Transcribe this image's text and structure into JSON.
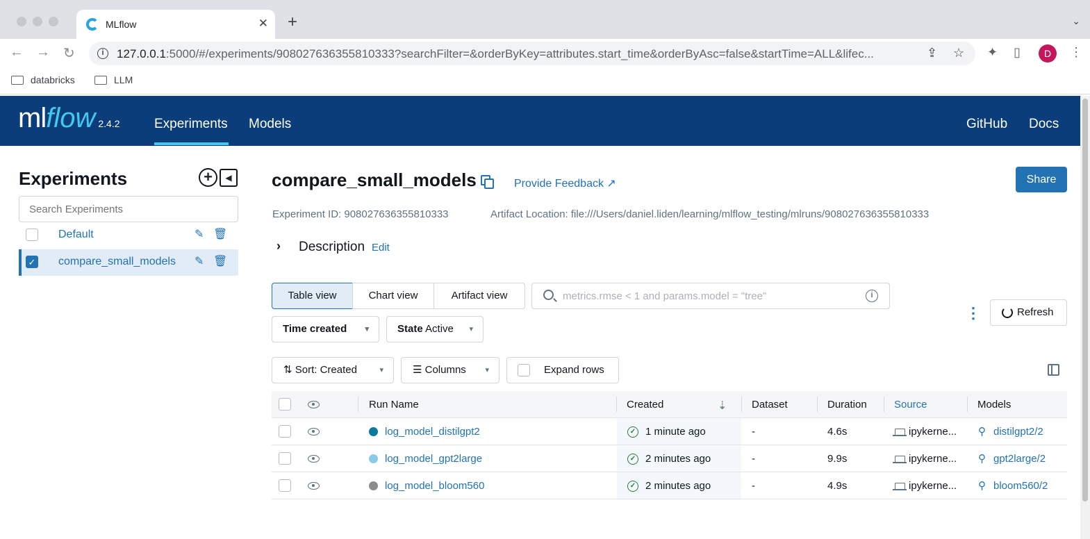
{
  "browser": {
    "tab_title": "MLflow",
    "url_host": "127.0.0.1",
    "url_rest": ":5000/#/experiments/908027636355810333?searchFilter=&orderByKey=attributes.start_time&orderByAsc=false&startTime=ALL&lifec...",
    "profile_initial": "D",
    "bookmarks": [
      "databricks",
      "LLM"
    ]
  },
  "header": {
    "logo_ml": "ml",
    "logo_flow": "flow",
    "version": "2.4.2",
    "nav": [
      "Experiments",
      "Models"
    ],
    "right_links": [
      "GitHub",
      "Docs"
    ]
  },
  "sidebar": {
    "title": "Experiments",
    "search_placeholder": "Search Experiments",
    "experiments": [
      {
        "name": "Default",
        "selected": false
      },
      {
        "name": "compare_small_models",
        "selected": true
      }
    ]
  },
  "experiment": {
    "name": "compare_small_models",
    "feedback_label": "Provide Feedback",
    "share_label": "Share",
    "id_text": "Experiment ID: 908027636355810333",
    "artifact_text": "Artifact Location: file:///Users/daniel.liden/learning/mlflow_testing/mlruns/908027636355810333",
    "description_label": "Description",
    "description_edit": "Edit"
  },
  "controls": {
    "views": [
      "Table view",
      "Chart view",
      "Artifact view"
    ],
    "search_placeholder": "metrics.rmse < 1 and params.model = \"tree\"",
    "refresh_label": "Refresh",
    "time_filter": "Time created",
    "state_label": "State",
    "state_value": "Active",
    "sort_label": "Sort: Created",
    "columns_label": "Columns",
    "expand_label": "Expand rows"
  },
  "table": {
    "headers": [
      "Run Name",
      "Created",
      "Dataset",
      "Duration",
      "Source",
      "Models"
    ],
    "rows": [
      {
        "run": "log_model_distilgpt2",
        "color": "#077a9d",
        "created": "1 minute ago",
        "dataset": "-",
        "duration": "4.6s",
        "source": "ipykerne...",
        "model": "distilgpt2/2"
      },
      {
        "run": "log_model_gpt2large",
        "color": "#8bcae7",
        "created": "2 minutes ago",
        "dataset": "-",
        "duration": "9.9s",
        "source": "ipykerne...",
        "model": "gpt2large/2"
      },
      {
        "run": "log_model_bloom560",
        "color": "#8d8d8d",
        "created": "2 minutes ago",
        "dataset": "-",
        "duration": "4.9s",
        "source": "ipykerne...",
        "model": "bloom560/2"
      }
    ]
  }
}
